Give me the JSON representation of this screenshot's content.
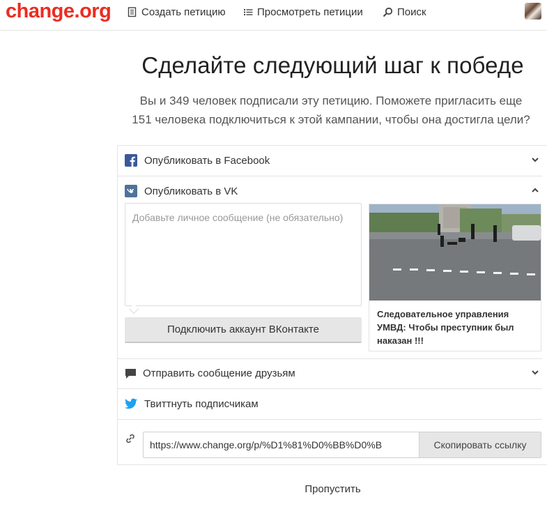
{
  "header": {
    "logo": "change.org",
    "nav": [
      {
        "label": "Создать петицию",
        "icon": "document-icon"
      },
      {
        "label": "Просмотреть петиции",
        "icon": "list-icon"
      },
      {
        "label": "Поиск",
        "icon": "search-icon"
      }
    ]
  },
  "main": {
    "title": "Сделайте следующий шаг к победе",
    "subtitle_line1": "Вы и 349 человек подписали эту петицию. Поможете пригласить еще",
    "subtitle_line2": "151 человека подключиться к этой кампании, чтобы она достигла цели?"
  },
  "share": {
    "facebook": {
      "label": "Опубликовать в Facebook",
      "color": "#3b5998"
    },
    "vk": {
      "label": "Опубликовать в VK",
      "color": "#507299",
      "message_placeholder": "Добавьте личное сообщение (не обязательно)",
      "connect_label": "Подключить аккаунт ВКонтакте",
      "card_caption": "Следовательное управления УМВД: Чтобы преступник был наказан !!!"
    },
    "message": {
      "label": "Отправить сообщение друзьям"
    },
    "twitter": {
      "label": "Твиттнуть подписчикам",
      "color": "#1da1f2"
    },
    "link": {
      "url": "https://www.change.org/p/%D1%81%D0%BB%D0%B",
      "copy_label": "Скопировать ссылку"
    }
  },
  "skip_label": "Пропустить",
  "colors": {
    "brand": "#ec2c22"
  }
}
